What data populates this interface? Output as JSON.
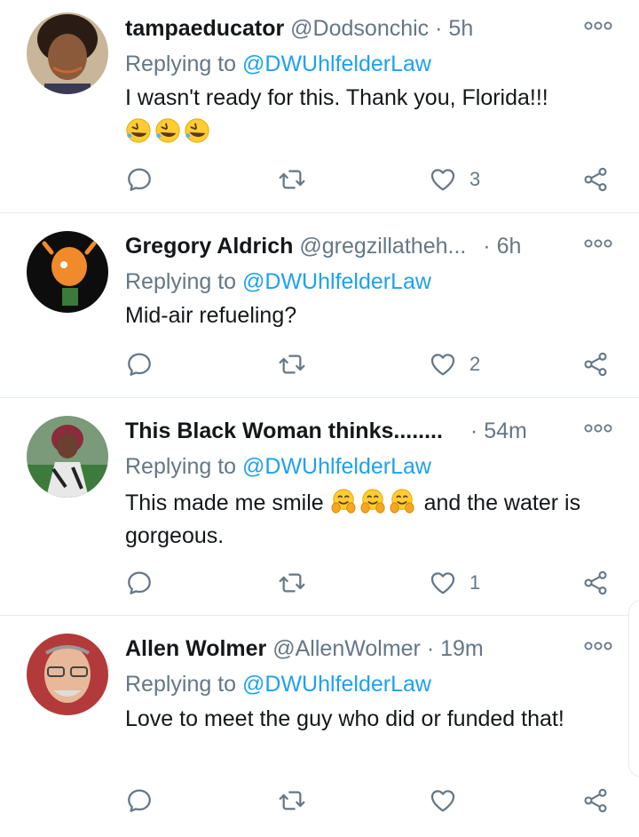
{
  "tweets": [
    {
      "name": "tampaeducator",
      "handle": "@Dodsonchic",
      "dot": "·",
      "time": "5h",
      "reply_prefix": "Replying to",
      "reply_to": "@DWUhlfelderLaw",
      "text": "I wasn't ready for this. Thank you, Florida!!!",
      "emoji": [
        "rolling-on-floor-laughing",
        "rolling-on-floor-laughing",
        "rolling-on-floor-laughing"
      ],
      "likes": "3"
    },
    {
      "name": "Gregory Aldrich",
      "handle": "@gregzillatheh...",
      "dot": "·",
      "time": "6h",
      "reply_prefix": "Replying to",
      "reply_to": "@DWUhlfelderLaw",
      "text": "Mid-air refueling?",
      "likes": "2"
    },
    {
      "name": "This Black Woman thinks........",
      "handle": "",
      "dot": "·",
      "time": "54m",
      "reply_prefix": "Replying to",
      "reply_to": "@DWUhlfelderLaw",
      "text_before": "This made me smile",
      "emoji": [
        "hugging-face",
        "hugging-face",
        "hugging-face"
      ],
      "text_after": "and the water is gorgeous.",
      "likes": "1"
    },
    {
      "name": "Allen Wolmer",
      "handle": "@AllenWolmer",
      "dot": "·",
      "time": "19m",
      "reply_prefix": "Replying to",
      "reply_to": "@DWUhlfelderLaw",
      "text": "Love to meet the guy who did or funded that!",
      "likes": ""
    }
  ],
  "icons": {
    "reply": "reply-icon",
    "retweet": "retweet-icon",
    "like": "heart-icon",
    "share": "share-icon",
    "more": "more-options-icon"
  },
  "colors": {
    "link": "#1da1f2",
    "secondary": "#657786",
    "text": "#14171a",
    "divider": "#e6ecf0"
  }
}
